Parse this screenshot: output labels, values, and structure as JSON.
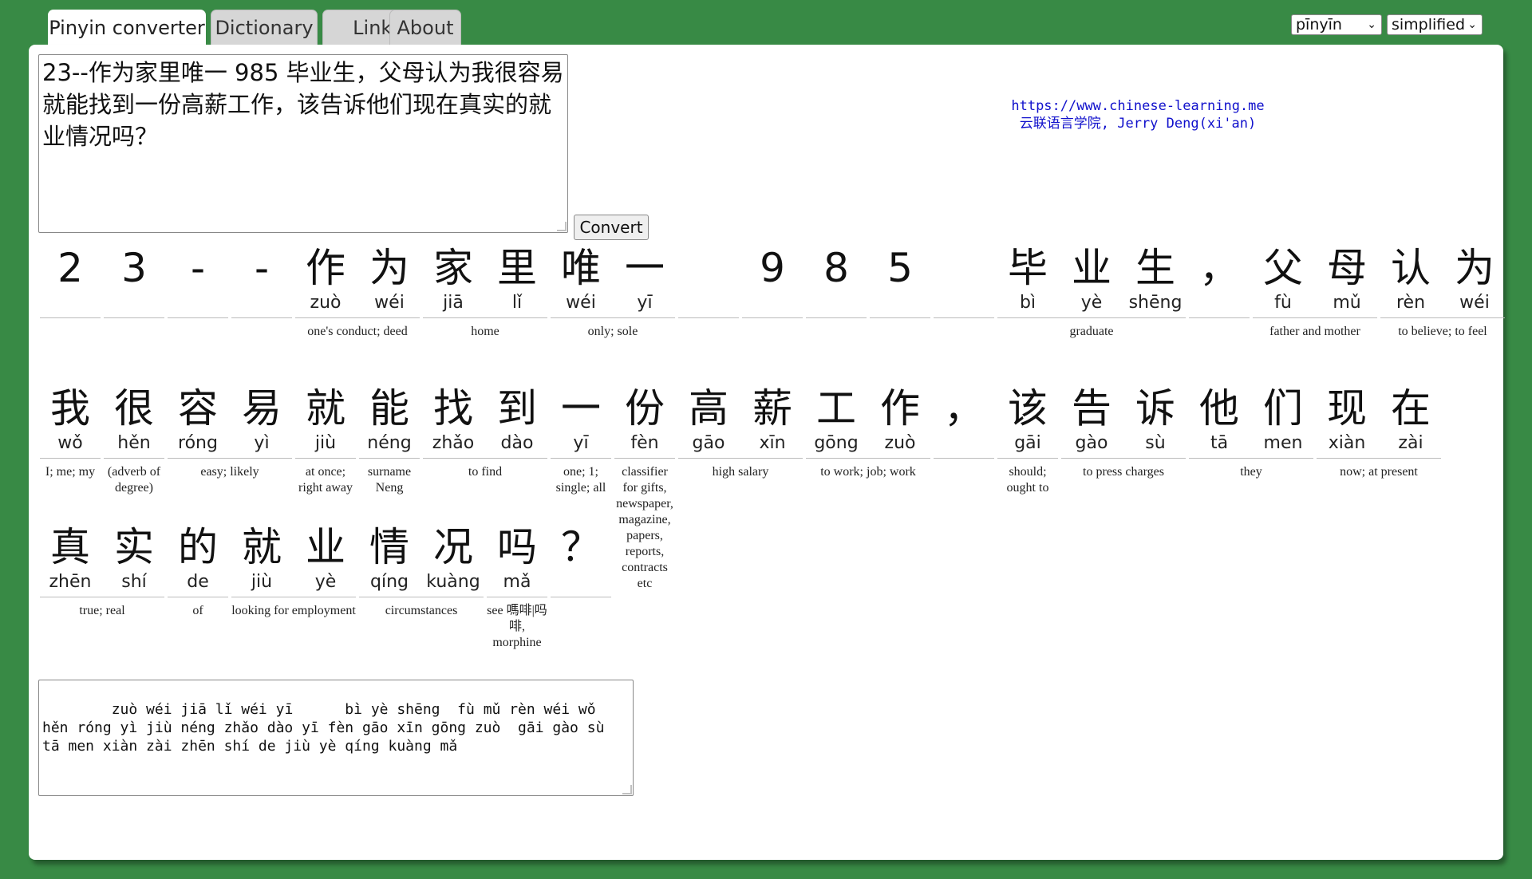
{
  "tabs": [
    "Pinyin converter",
    "Dictionary",
    "Links",
    "About"
  ],
  "selects": {
    "mode": "pīnyīn",
    "script": "simplified"
  },
  "input_text": "23--作为家里唯一 985 毕业生，父母认为我很容易就能找到一份高薪工作，该告诉他们现在真实的就业情况吗？",
  "convert_label": "Convert",
  "credit": {
    "url": "https://www.chinese-learning.me",
    "line2": "云联语言学院, Jerry Deng(xi'an)"
  },
  "rows": [
    {
      "chars": [
        {
          "h": "2",
          "p": ""
        },
        {
          "h": "3",
          "p": ""
        },
        {
          "h": "-",
          "p": ""
        },
        {
          "h": "-",
          "p": ""
        },
        {
          "h": "作",
          "p": "zuò"
        },
        {
          "h": "为",
          "p": "wéi"
        },
        {
          "h": "家",
          "p": "jiā"
        },
        {
          "h": "里",
          "p": "lǐ"
        },
        {
          "h": "唯",
          "p": "wéi"
        },
        {
          "h": "一",
          "p": "yī"
        },
        {
          "h": "",
          "p": ""
        },
        {
          "h": "9",
          "p": ""
        },
        {
          "h": "8",
          "p": ""
        },
        {
          "h": "5",
          "p": ""
        },
        {
          "h": "",
          "p": ""
        },
        {
          "h": "毕",
          "p": "bì"
        },
        {
          "h": "业",
          "p": "yè"
        },
        {
          "h": "生",
          "p": "shēng"
        },
        {
          "h": "，",
          "p": ""
        },
        {
          "h": "父",
          "p": "fù"
        },
        {
          "h": "母",
          "p": "mǔ"
        },
        {
          "h": "认",
          "p": "rèn"
        },
        {
          "h": "为",
          "p": "wéi"
        }
      ],
      "words": [
        [
          0,
          1
        ],
        [
          1,
          1
        ],
        [
          2,
          1
        ],
        [
          3,
          1
        ],
        [
          4,
          2
        ],
        [
          6,
          2
        ],
        [
          8,
          2
        ],
        [
          10,
          1
        ],
        [
          11,
          1
        ],
        [
          12,
          1
        ],
        [
          13,
          1
        ],
        [
          14,
          1
        ],
        [
          15,
          3
        ],
        [
          18,
          1
        ],
        [
          19,
          2
        ],
        [
          21,
          2
        ]
      ],
      "glosses": [
        {
          "start": 4,
          "len": 2,
          "text": "one's conduct; deed"
        },
        {
          "start": 6,
          "len": 2,
          "text": "home"
        },
        {
          "start": 8,
          "len": 2,
          "text": "only; sole"
        },
        {
          "start": 15,
          "len": 3,
          "text": "graduate"
        },
        {
          "start": 19,
          "len": 2,
          "text": "father and mother"
        },
        {
          "start": 21,
          "len": 2,
          "text": "to believe; to feel"
        }
      ]
    },
    {
      "chars": [
        {
          "h": "我",
          "p": "wǒ"
        },
        {
          "h": "很",
          "p": "hěn"
        },
        {
          "h": "容",
          "p": "róng"
        },
        {
          "h": "易",
          "p": "yì"
        },
        {
          "h": "就",
          "p": "jiù"
        },
        {
          "h": "能",
          "p": "néng"
        },
        {
          "h": "找",
          "p": "zhǎo"
        },
        {
          "h": "到",
          "p": "dào"
        },
        {
          "h": "一",
          "p": "yī"
        },
        {
          "h": "份",
          "p": "fèn"
        },
        {
          "h": "高",
          "p": "gāo"
        },
        {
          "h": "薪",
          "p": "xīn"
        },
        {
          "h": "工",
          "p": "gōng"
        },
        {
          "h": "作",
          "p": "zuò"
        },
        {
          "h": "，",
          "p": ""
        },
        {
          "h": "该",
          "p": "gāi"
        },
        {
          "h": "告",
          "p": "gào"
        },
        {
          "h": "诉",
          "p": "sù"
        },
        {
          "h": "他",
          "p": "tā"
        },
        {
          "h": "们",
          "p": "men"
        },
        {
          "h": "现",
          "p": "xiàn"
        },
        {
          "h": "在",
          "p": "zài"
        }
      ],
      "words": [
        [
          0,
          1
        ],
        [
          1,
          1
        ],
        [
          2,
          2
        ],
        [
          4,
          1
        ],
        [
          5,
          1
        ],
        [
          6,
          2
        ],
        [
          8,
          1
        ],
        [
          9,
          1
        ],
        [
          10,
          2
        ],
        [
          12,
          2
        ],
        [
          14,
          1
        ],
        [
          15,
          1
        ],
        [
          16,
          2
        ],
        [
          18,
          2
        ],
        [
          20,
          2
        ]
      ],
      "glosses": [
        {
          "start": 0,
          "len": 1,
          "text": "I; me; my"
        },
        {
          "start": 1,
          "len": 1,
          "text": "(adverb of degree)"
        },
        {
          "start": 2,
          "len": 2,
          "text": "easy; likely"
        },
        {
          "start": 4,
          "len": 1,
          "text": "at once; right away"
        },
        {
          "start": 5,
          "len": 1,
          "text": "surname Neng"
        },
        {
          "start": 6,
          "len": 2,
          "text": "to find"
        },
        {
          "start": 8,
          "len": 1,
          "text": "one; 1; single; all"
        },
        {
          "start": 9,
          "len": 1,
          "text": "classifier for gifts, newspaper, magazine, papers, reports, contracts etc"
        },
        {
          "start": 10,
          "len": 2,
          "text": "high salary"
        },
        {
          "start": 12,
          "len": 2,
          "text": "to work; job; work"
        },
        {
          "start": 15,
          "len": 1,
          "text": "should; ought to"
        },
        {
          "start": 16,
          "len": 2,
          "text": "to press charges"
        },
        {
          "start": 18,
          "len": 2,
          "text": "they"
        },
        {
          "start": 20,
          "len": 2,
          "text": "now; at present"
        }
      ]
    },
    {
      "chars": [
        {
          "h": "真",
          "p": "zhēn"
        },
        {
          "h": "实",
          "p": "shí"
        },
        {
          "h": "的",
          "p": "de"
        },
        {
          "h": "就",
          "p": "jiù"
        },
        {
          "h": "业",
          "p": "yè"
        },
        {
          "h": "情",
          "p": "qíng"
        },
        {
          "h": "况",
          "p": "kuàng"
        },
        {
          "h": "吗",
          "p": "mǎ"
        },
        {
          "h": "？",
          "p": ""
        }
      ],
      "words": [
        [
          0,
          2
        ],
        [
          2,
          1
        ],
        [
          3,
          2
        ],
        [
          5,
          2
        ],
        [
          7,
          1
        ],
        [
          8,
          1
        ]
      ],
      "glosses": [
        {
          "start": 0,
          "len": 2,
          "text": "true; real"
        },
        {
          "start": 2,
          "len": 1,
          "text": "of"
        },
        {
          "start": 3,
          "len": 2,
          "text": "looking for employment"
        },
        {
          "start": 5,
          "len": 2,
          "text": "circumstances"
        },
        {
          "start": 7,
          "len": 1,
          "text": "see 嗎啡|吗啡, morphine"
        }
      ]
    }
  ],
  "output_text": "    zuò wéi jiā lǐ wéi yī      bì yè shēng  fù mǔ rèn wéi wǒ hěn róng yì jiù néng zhǎo dào yī fèn gāo xīn gōng zuò  gāi gào sù tā men xiàn zài zhēn shí de jiù yè qíng kuàng mǎ"
}
